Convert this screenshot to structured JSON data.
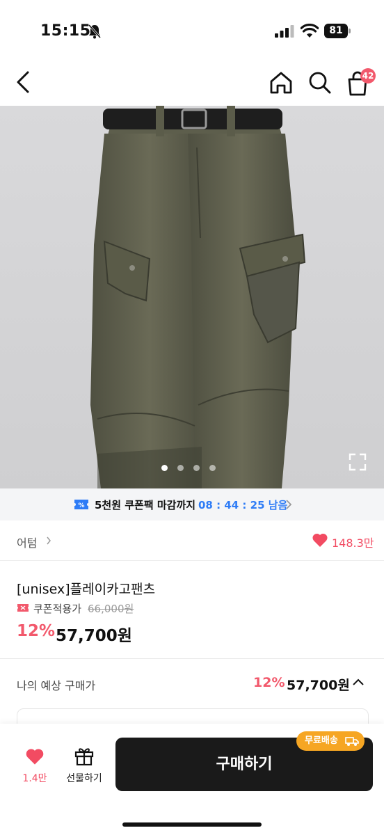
{
  "status_bar": {
    "time": "15:15",
    "battery": "81"
  },
  "nav": {
    "cart_count": "42"
  },
  "hero": {
    "slide_count": 4,
    "active_slide": 0
  },
  "coupon_banner": {
    "text": "5천원 쿠폰팩 마감까지",
    "timer": "08 : 44 : 25 남음"
  },
  "brand": {
    "name": "어텀",
    "like_count": "148.3만"
  },
  "product": {
    "name": "[unisex]플레이카고팬츠",
    "coupon_label": "쿠폰적용가",
    "original_price": "66,000원",
    "discount_rate": "12%",
    "sale_price": "57,700원"
  },
  "estimate": {
    "label": "나의 예상 구매가",
    "rate": "12%",
    "price": "57,700원"
  },
  "bottom_bar": {
    "wish_count": "1.4만",
    "gift_label": "선물하기",
    "buy_label": "구매하기",
    "shipping_badge": "무료배송"
  },
  "colors": {
    "accent": "#f2596c",
    "timer_blue": "#2e7cf6",
    "badge_orange": "#f6a623",
    "buy_button": "#1a1a1a"
  },
  "icons": [
    "bell-slash-icon",
    "signal-icon",
    "wifi-icon",
    "back-arrow-icon",
    "home-icon",
    "search-icon",
    "shopping-bag-icon",
    "expand-icon",
    "ticket-icon",
    "chevron-right-icon",
    "heart-icon",
    "coupon-tag-icon",
    "chevron-up-icon",
    "gift-icon",
    "truck-icon"
  ]
}
